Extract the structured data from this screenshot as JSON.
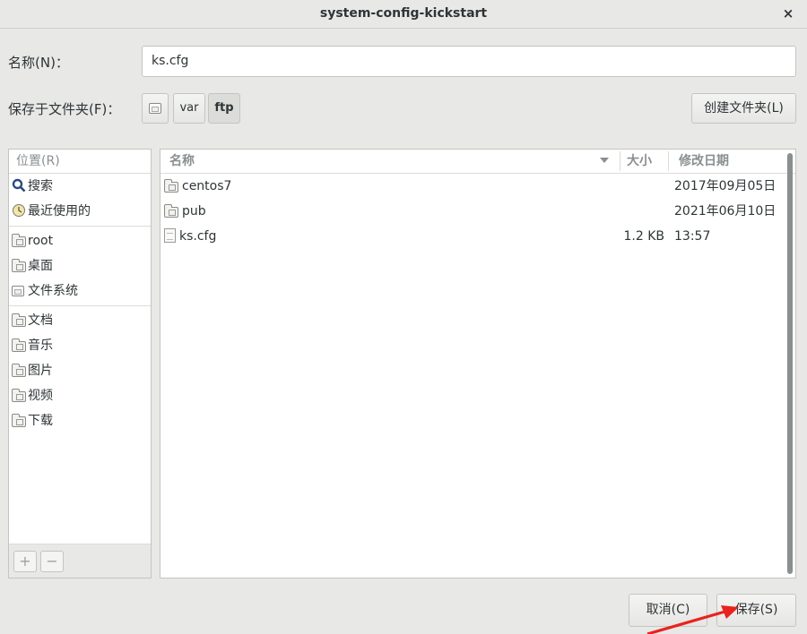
{
  "window": {
    "title": "system-config-kickstart",
    "close_glyph": "×"
  },
  "name_row": {
    "label": "名称(N)：",
    "value": "ks.cfg"
  },
  "folder_row": {
    "label": "保存于文件夹(F)：",
    "path": [
      {
        "label": "",
        "icon": "drive-icon"
      },
      {
        "label": "var"
      },
      {
        "label": "ftp"
      }
    ],
    "create_folder_label": "创建文件夹(L)"
  },
  "places": {
    "header": "位置(R)",
    "items": [
      {
        "label": "搜索",
        "icon": "search-icon"
      },
      {
        "label": "最近使用的",
        "icon": "recent-icon"
      },
      {
        "label": "root",
        "icon": "home-folder-icon"
      },
      {
        "label": "桌面",
        "icon": "desktop-folder-icon"
      },
      {
        "label": "文件系统",
        "icon": "drive-icon"
      },
      {
        "label": "文档",
        "icon": "documents-folder-icon"
      },
      {
        "label": "音乐",
        "icon": "music-folder-icon"
      },
      {
        "label": "图片",
        "icon": "pictures-folder-icon"
      },
      {
        "label": "视频",
        "icon": "videos-folder-icon"
      },
      {
        "label": "下载",
        "icon": "downloads-folder-icon"
      }
    ],
    "add_label": "+",
    "remove_label": "−"
  },
  "files": {
    "columns": {
      "name": "名称",
      "size": "大小",
      "modified": "修改日期"
    },
    "rows": [
      {
        "name": "centos7",
        "type": "folder",
        "size": "",
        "modified": "2017年09月05日"
      },
      {
        "name": "pub",
        "type": "folder",
        "size": "",
        "modified": "2021年06月10日"
      },
      {
        "name": "ks.cfg",
        "type": "file",
        "size": "1.2 KB",
        "modified": "13:57"
      }
    ]
  },
  "buttons": {
    "cancel": "取消(C)",
    "save": "保存(S)"
  },
  "colors": {
    "annotation_arrow": "#e8231f"
  }
}
